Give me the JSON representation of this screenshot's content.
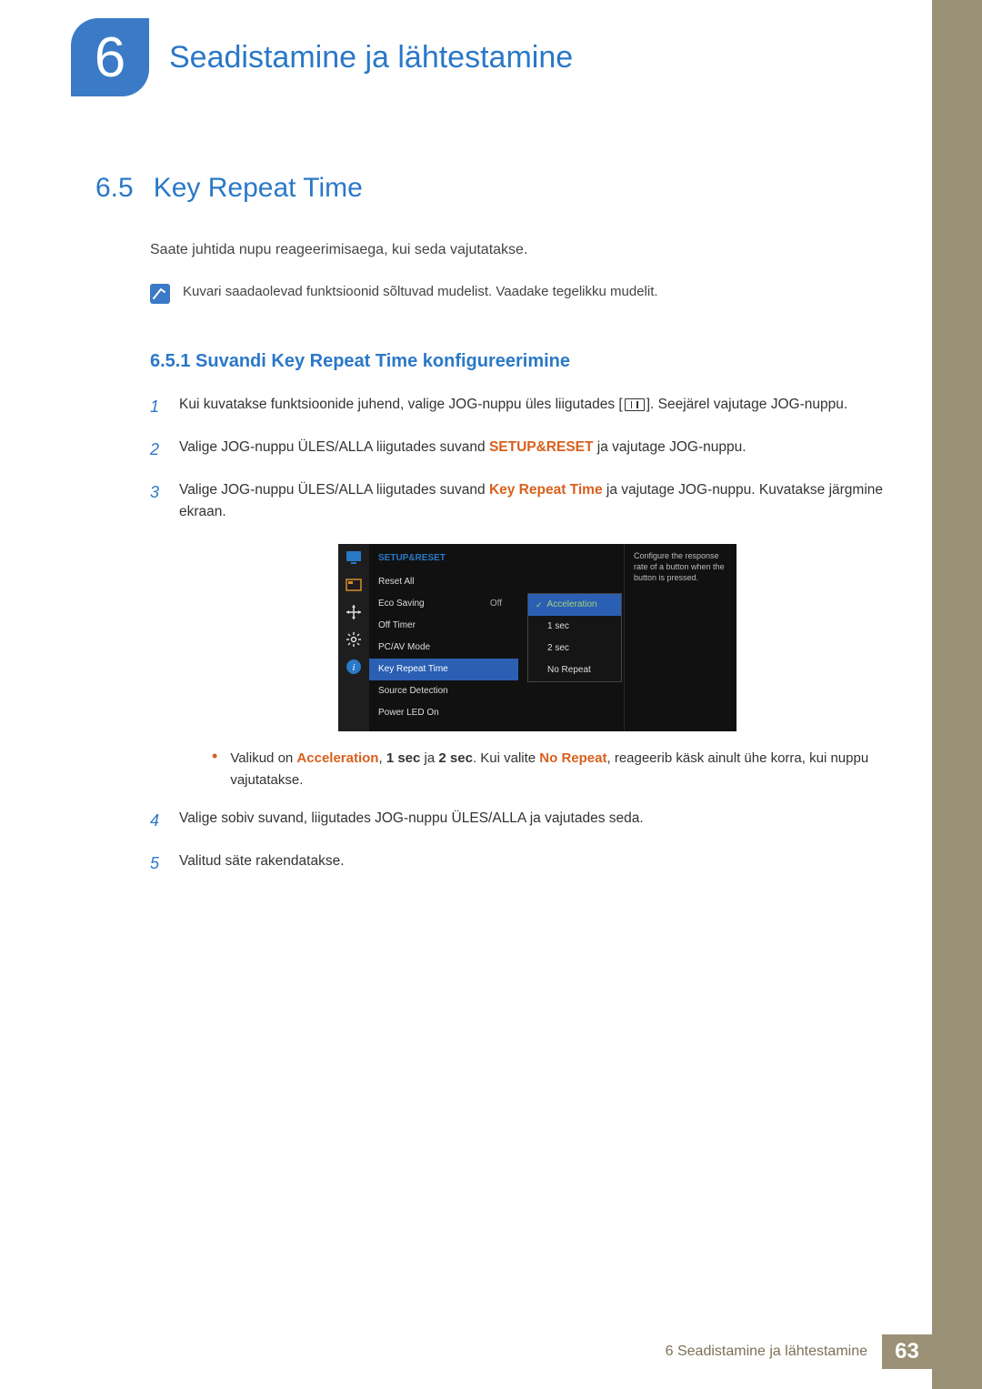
{
  "chapter": {
    "number": "6",
    "title": "Seadistamine ja lähtestamine"
  },
  "section": {
    "number": "6.5",
    "title": "Key Repeat Time"
  },
  "intro": "Saate juhtida nupu reageerimisaega, kui seda vajutatakse.",
  "note": "Kuvari saadaolevad funktsioonid sõltuvad mudelist. Vaadake tegelikku mudelit.",
  "subsection": "6.5.1   Suvandi Key Repeat Time konfigureerimine",
  "steps": {
    "s1a": "Kui kuvatakse funktsioonide juhend, valige JOG-nuppu üles liigutades [",
    "s1b": "]. Seejärel vajutage JOG-nuppu.",
    "s2a": "Valige JOG-nuppu ÜLES/ALLA liigutades suvand ",
    "s2b": " ja vajutage JOG-nuppu.",
    "s2m": "SETUP&RESET",
    "s3a": "Valige JOG-nuppu ÜLES/ALLA liigutades suvand ",
    "s3m": "Key Repeat Time",
    "s3b": " ja vajutage JOG-nuppu. Kuvatakse järgmine ekraan.",
    "bullet_a": "Valikud on ",
    "bullet_m1": "Acceleration",
    "bullet_sep": ", ",
    "bullet_m2": "1 sec",
    "bullet_and": " ja ",
    "bullet_m3": "2 sec",
    "bullet_mid": ". Kui valite ",
    "bullet_m4": "No Repeat",
    "bullet_b": ", reageerib käsk ainult ühe korra, kui nuppu vajutatakse.",
    "s4": "Valige sobiv suvand, liigutades JOG-nuppu ÜLES/ALLA ja vajutades seda.",
    "s5": "Valitud säte rakendatakse."
  },
  "osd": {
    "head": "SETUP&RESET",
    "items": [
      {
        "label": "Reset All",
        "value": ""
      },
      {
        "label": "Eco Saving",
        "value": "Off"
      },
      {
        "label": "Off Timer",
        "value": ""
      },
      {
        "label": "PC/AV Mode",
        "value": ""
      },
      {
        "label": "Key Repeat Time",
        "value": ""
      },
      {
        "label": "Source Detection",
        "value": ""
      },
      {
        "label": "Power LED On",
        "value": ""
      }
    ],
    "popup": [
      "Acceleration",
      "1 sec",
      "2 sec",
      "No Repeat"
    ],
    "desc": "Configure the response rate of a button when the button is pressed."
  },
  "footer": {
    "text": "6 Seadistamine ja lähtestamine",
    "page": "63"
  },
  "nums": {
    "n1": "1",
    "n2": "2",
    "n3": "3",
    "n4": "4",
    "n5": "5"
  }
}
